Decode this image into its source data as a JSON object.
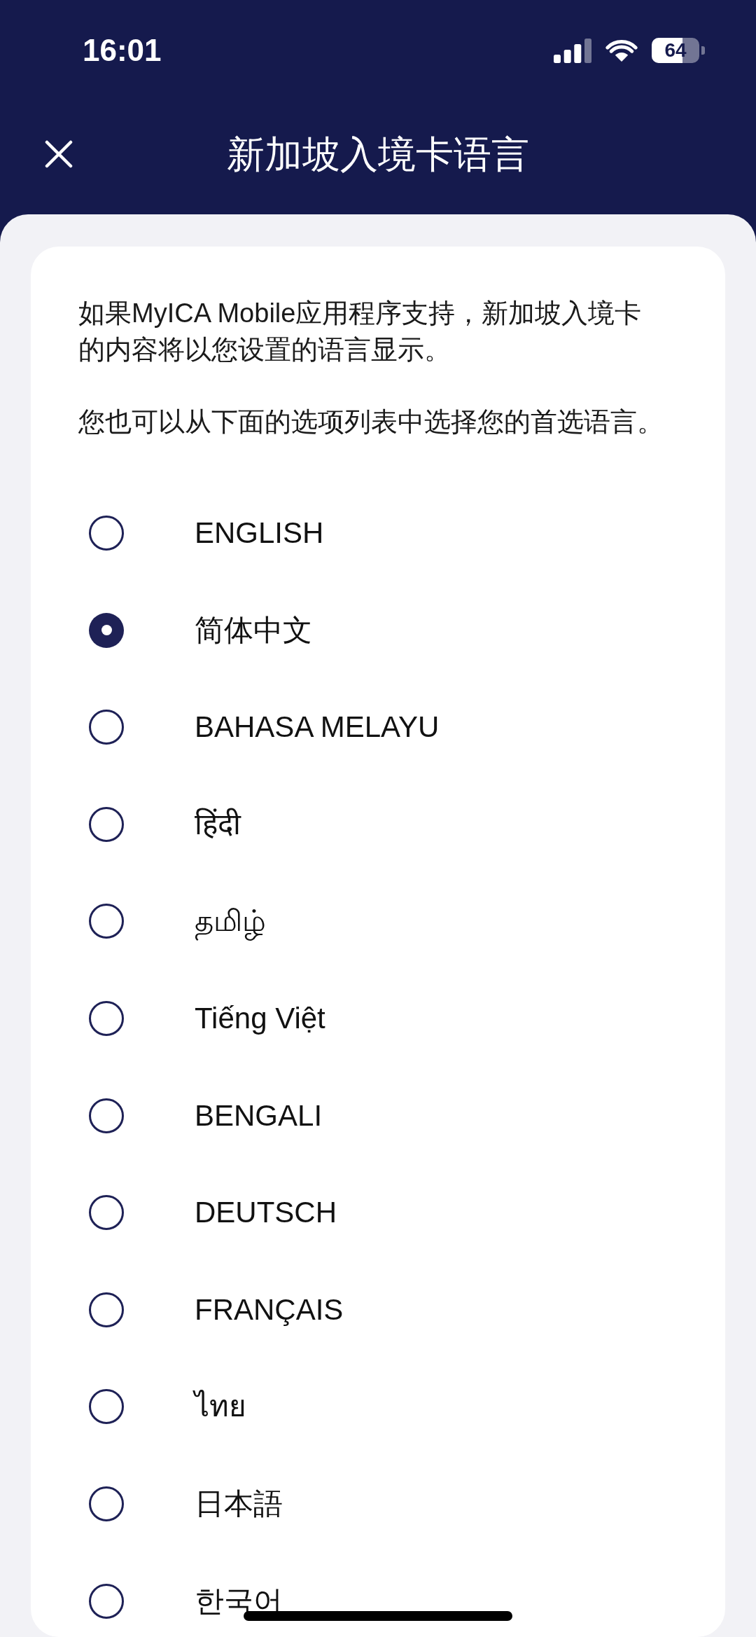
{
  "status_bar": {
    "time": "16:01",
    "battery": "64"
  },
  "header": {
    "title": "新加坡入境卡语言"
  },
  "intro": [
    "如果MyICA Mobile应用程序支持，新加坡入境卡的内容将以您设置的语言显示。",
    "您也可以从下面的选项列表中选择您的首选语言。"
  ],
  "languages": [
    {
      "label": "ENGLISH",
      "selected": false
    },
    {
      "label": "简体中文",
      "selected": true
    },
    {
      "label": "BAHASA MELAYU",
      "selected": false
    },
    {
      "label": "हिंदी",
      "selected": false
    },
    {
      "label": "தமிழ்",
      "selected": false
    },
    {
      "label": "Tiếng Việt",
      "selected": false
    },
    {
      "label": "BENGALI",
      "selected": false
    },
    {
      "label": "DEUTSCH",
      "selected": false
    },
    {
      "label": "FRANÇAIS",
      "selected": false
    },
    {
      "label": "ไทย",
      "selected": false
    },
    {
      "label": "日本語",
      "selected": false
    },
    {
      "label": "한국어",
      "selected": false
    }
  ]
}
